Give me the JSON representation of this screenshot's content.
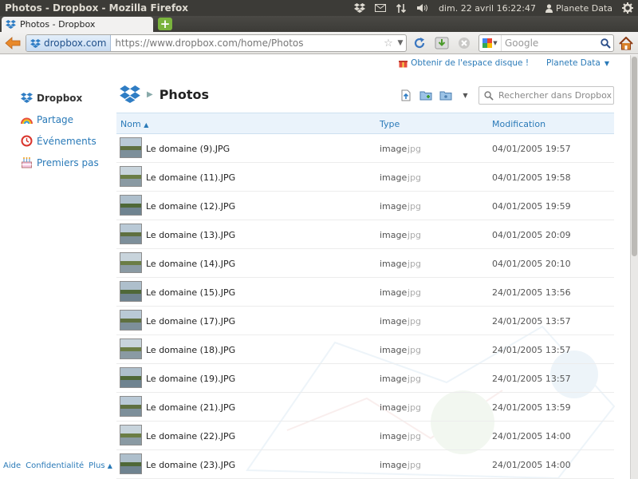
{
  "window": {
    "title": "Photos - Dropbox - Mozilla Firefox",
    "clock": "dim. 22 avril 16:22:47",
    "user": "Planete Data"
  },
  "browser": {
    "tab_title": "Photos - Dropbox",
    "identity": "dropbox.com",
    "url": "https://www.dropbox.com/home/Photos",
    "search_placeholder": "Google"
  },
  "page": {
    "get_space": "Obtenir de l'espace disque !",
    "account": "Planete Data",
    "folder_title": "Photos",
    "search_placeholder": "Rechercher dans Dropbox"
  },
  "sidebar": {
    "items": [
      {
        "label": "Dropbox",
        "icon": "dropbox-icon"
      },
      {
        "label": "Partage",
        "icon": "rainbow-icon"
      },
      {
        "label": "Événements",
        "icon": "clock-icon"
      },
      {
        "label": "Premiers pas",
        "icon": "cake-icon"
      }
    ]
  },
  "footer": {
    "help": "Aide",
    "privacy": "Confidentialité",
    "more": "Plus"
  },
  "table": {
    "headers": {
      "name": "Nom",
      "type": "Type",
      "modified": "Modification"
    },
    "rows": [
      {
        "name": "Le domaine (9).JPG",
        "kind": "image",
        "ext": "jpg",
        "date": "04/01/2005 19:57"
      },
      {
        "name": "Le domaine (11).JPG",
        "kind": "image",
        "ext": "jpg",
        "date": "04/01/2005 19:58"
      },
      {
        "name": "Le domaine (12).JPG",
        "kind": "image",
        "ext": "jpg",
        "date": "04/01/2005 19:59"
      },
      {
        "name": "Le domaine (13).JPG",
        "kind": "image",
        "ext": "jpg",
        "date": "04/01/2005 20:09"
      },
      {
        "name": "Le domaine (14).JPG",
        "kind": "image",
        "ext": "jpg",
        "date": "04/01/2005 20:10"
      },
      {
        "name": "Le domaine (15).JPG",
        "kind": "image",
        "ext": "jpg",
        "date": "24/01/2005 13:56"
      },
      {
        "name": "Le domaine (17).JPG",
        "kind": "image",
        "ext": "jpg",
        "date": "24/01/2005 13:57"
      },
      {
        "name": "Le domaine (18).JPG",
        "kind": "image",
        "ext": "jpg",
        "date": "24/01/2005 13:57"
      },
      {
        "name": "Le domaine (19).JPG",
        "kind": "image",
        "ext": "jpg",
        "date": "24/01/2005 13:57"
      },
      {
        "name": "Le domaine (21).JPG",
        "kind": "image",
        "ext": "jpg",
        "date": "24/01/2005 13:59"
      },
      {
        "name": "Le domaine (22).JPG",
        "kind": "image",
        "ext": "jpg",
        "date": "24/01/2005 14:00"
      },
      {
        "name": "Le domaine (23).JPG",
        "kind": "image",
        "ext": "jpg",
        "date": "24/01/2005 14:00"
      }
    ]
  },
  "colors": {
    "link": "#2a7ab8",
    "header_bg": "#eaf3fb",
    "panel": "#3c3b37"
  }
}
